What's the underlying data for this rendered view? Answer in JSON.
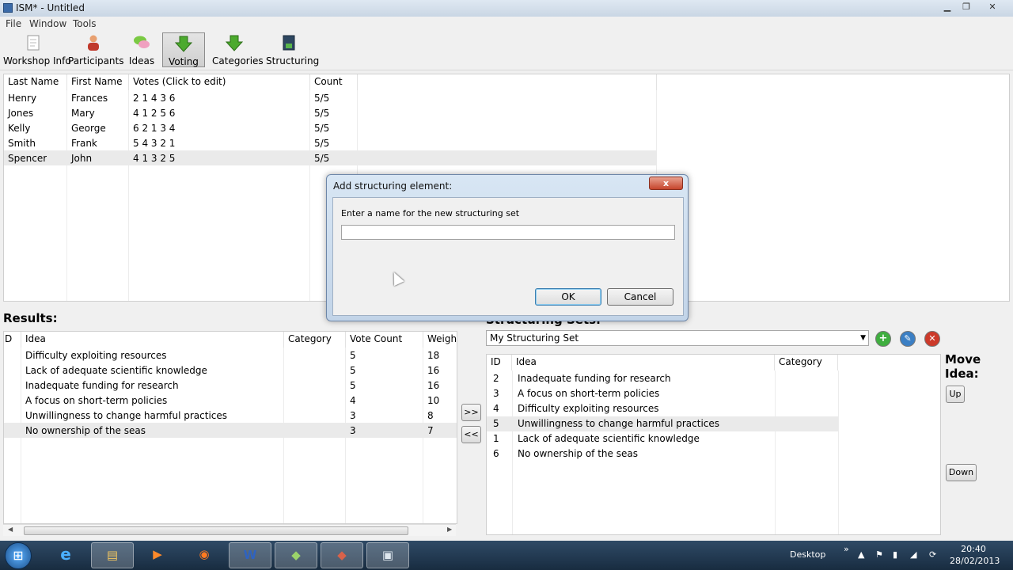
{
  "window": {
    "title": "ISM* - Untitled"
  },
  "window_controls": {
    "minimize": "▁",
    "maximize": "❐",
    "close": "✕"
  },
  "menu": [
    "File",
    "Window",
    "Tools"
  ],
  "toolbar": [
    {
      "label": "Workshop Info",
      "icon": "notepad-icon"
    },
    {
      "label": "Participants",
      "icon": "person-icon"
    },
    {
      "label": "Ideas",
      "icon": "speech-bubbles-icon"
    },
    {
      "label": "Voting",
      "icon": "green-arrow-down-icon",
      "active": true
    },
    {
      "label": "Categories",
      "icon": "green-arrow-down-icon"
    },
    {
      "label": "Structuring",
      "icon": "book-icon"
    }
  ],
  "participants_table": {
    "headers": [
      "Last Name",
      "First Name",
      "Votes (Click to edit)",
      "Count"
    ],
    "rows": [
      [
        "Henry",
        "Frances",
        "2 1 4 3 6",
        "5/5"
      ],
      [
        "Jones",
        "Mary",
        "4 1 2 5 6",
        "5/5"
      ],
      [
        "Kelly",
        "George",
        "6 2 1 3 4",
        "5/5"
      ],
      [
        "Smith",
        "Frank",
        "5 4 3 2 1",
        "5/5"
      ],
      [
        "Spencer",
        "John",
        "4 1 3 2 5",
        "5/5"
      ]
    ],
    "selected_row": 4
  },
  "results": {
    "title": "Results:",
    "headers": [
      "D",
      "Idea",
      "Category",
      "Vote Count",
      "Weight"
    ],
    "rows": [
      [
        "",
        "Difficulty exploiting resources",
        "",
        "5",
        "18"
      ],
      [
        "",
        "Lack of adequate scientific knowledge",
        "",
        "5",
        "16"
      ],
      [
        "",
        "Inadequate funding for research",
        "",
        "5",
        "16"
      ],
      [
        "",
        "A focus on short-term policies",
        "",
        "4",
        "10"
      ],
      [
        "",
        "Unwillingness to change harmful practices",
        "",
        "3",
        "8"
      ],
      [
        "",
        "No ownership of the seas",
        "",
        "3",
        "7"
      ]
    ],
    "selected_row": 5
  },
  "transfer_buttons": {
    "add": ">>",
    "remove": "<<"
  },
  "structuring": {
    "title": "Structuring Sets:",
    "selected_set": "My Structuring Set",
    "add_glyph": "+",
    "edit_glyph": "✎",
    "delete_glyph": "✕",
    "headers": [
      "ID",
      "Idea",
      "Category"
    ],
    "rows": [
      [
        "2",
        "Inadequate funding for research",
        ""
      ],
      [
        "3",
        "A focus on short-term policies",
        ""
      ],
      [
        "4",
        "Difficulty exploiting resources",
        ""
      ],
      [
        "5",
        "Unwillingness to change harmful practices",
        ""
      ],
      [
        "1",
        "Lack of adequate scientific knowledge",
        ""
      ],
      [
        "6",
        "No ownership of the seas",
        ""
      ]
    ],
    "selected_row": 3
  },
  "move_idea": {
    "title": "Move Idea:",
    "up": "Up",
    "down": "Down"
  },
  "dialog": {
    "title": "Add structuring element:",
    "close_glyph": "x",
    "prompt": "Enter a name for the new structuring set",
    "input_value": "",
    "ok": "OK",
    "cancel": "Cancel"
  },
  "taskbar": {
    "start_glyph": "⊞",
    "apps": [
      {
        "name": "internet-explorer-icon",
        "glyph": "e"
      },
      {
        "name": "file-explorer-icon",
        "glyph": "▤"
      },
      {
        "name": "media-player-icon",
        "glyph": "▶"
      },
      {
        "name": "firefox-icon",
        "glyph": "◉"
      },
      {
        "name": "word-icon",
        "glyph": "W"
      },
      {
        "name": "app-icon",
        "glyph": "◆"
      },
      {
        "name": "app-icon-2",
        "glyph": "◆"
      },
      {
        "name": "ism-app-icon",
        "glyph": "▣"
      }
    ],
    "desktop_label": "Desktop",
    "tray_glyphs": [
      "»",
      "▲",
      "⚑",
      "▮",
      "◢",
      "⟳"
    ],
    "time": "20:40",
    "date": "28/02/2013"
  },
  "colors": {
    "selection": "#eaeaea",
    "dialog_ok_border": "#3c7fb1",
    "add_green": "#3fae3f",
    "edit_blue": "#3b7fc4",
    "delete_red": "#cc3a2a"
  }
}
